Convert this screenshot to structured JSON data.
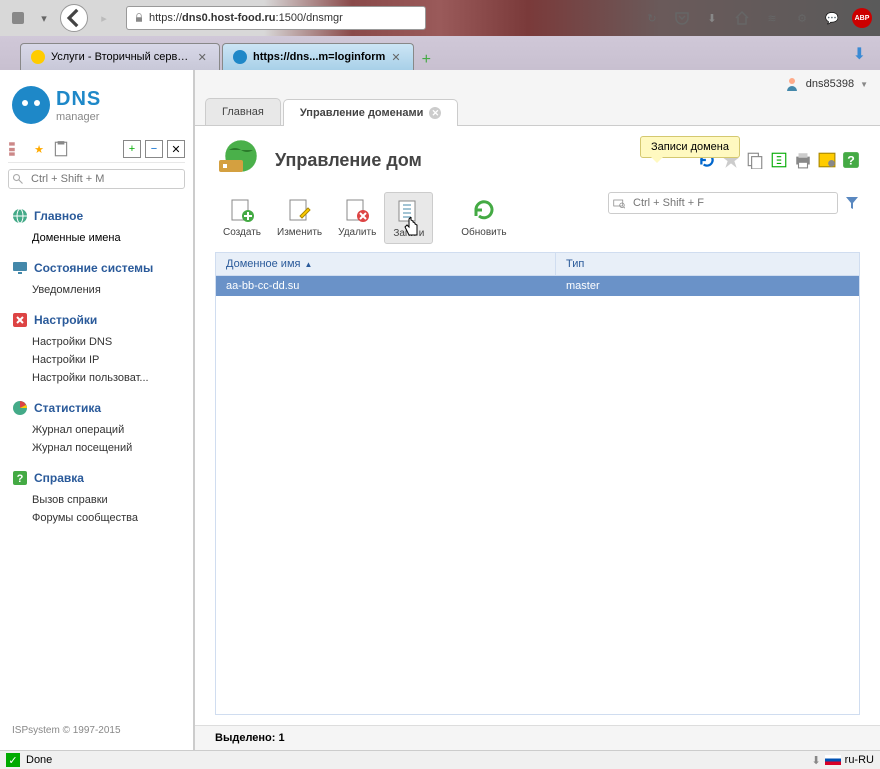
{
  "browser": {
    "url_prefix": "https://",
    "url_host": "dns0.host-food.ru",
    "url_path": ":1500/dnsmgr",
    "tabs": [
      {
        "label": "Услуги - Вторичный сервер..."
      },
      {
        "label": "https://dns...m=loginform"
      }
    ]
  },
  "app": {
    "logo_big": "DNS",
    "logo_small": "manager",
    "user": "dns85398",
    "sidebar_search_placeholder": "Ctrl + Shift + M",
    "nav": [
      {
        "label": "Главное",
        "items": [
          {
            "label": "Доменные имена"
          }
        ]
      },
      {
        "label": "Состояние системы",
        "items": [
          {
            "label": "Уведомления"
          }
        ]
      },
      {
        "label": "Настройки",
        "items": [
          {
            "label": "Настройки DNS"
          },
          {
            "label": "Настройки IP"
          },
          {
            "label": "Настройки пользоват..."
          }
        ]
      },
      {
        "label": "Статистика",
        "items": [
          {
            "label": "Журнал операций"
          },
          {
            "label": "Журнал посещений"
          }
        ]
      },
      {
        "label": "Справка",
        "items": [
          {
            "label": "Вызов справки"
          },
          {
            "label": "Форумы сообщества"
          }
        ]
      }
    ],
    "copyright": "ISPsystem © 1997-2015",
    "main_tabs": [
      {
        "label": "Главная"
      },
      {
        "label": "Управление доменами"
      }
    ],
    "page_title": "Управление дом",
    "tooltip": "Записи домена",
    "actions": {
      "create": "Создать",
      "edit": "Изменить",
      "delete": "Удалить",
      "records": "Запи    и",
      "refresh": "Обновить"
    },
    "action_search_placeholder": "Ctrl + Shift + F",
    "table": {
      "col1": "Доменное имя",
      "col2": "Тип",
      "rows": [
        {
          "domain": "aa-bb-cc-dd.su",
          "type": "master"
        }
      ]
    },
    "footer_label": "Выделено:",
    "footer_count": "1"
  },
  "status": {
    "done": "Done",
    "locale": "ru-RU"
  }
}
